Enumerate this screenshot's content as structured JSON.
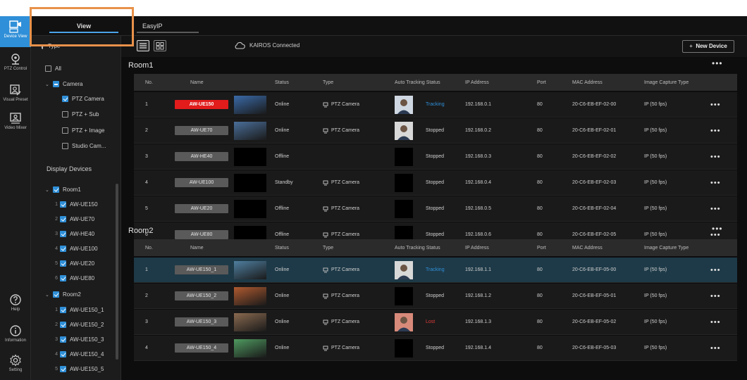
{
  "rail": {
    "items": [
      {
        "label": "Device View",
        "icon": "device-view-icon"
      },
      {
        "label": "PTZ Control",
        "icon": "ptz-control-icon"
      },
      {
        "label": "Visual Preset",
        "icon": "visual-preset-icon"
      },
      {
        "label": "Video Mixer",
        "icon": "video-mixer-icon"
      }
    ],
    "bottom": [
      {
        "label": "Help",
        "icon": "help-icon"
      },
      {
        "label": "Information",
        "icon": "information-icon"
      },
      {
        "label": "Setting",
        "icon": "settings-icon"
      }
    ]
  },
  "tabs": [
    {
      "label": "View"
    },
    {
      "label": "EasyIP"
    }
  ],
  "sidebar": {
    "type_label": "Type",
    "filter_all": "All",
    "camera": "Camera",
    "camera_types": [
      "PTZ Camera",
      "PTZ + Sub",
      "PTZ + Image",
      "Studio Cam..."
    ],
    "display_devices": "Display Devices",
    "room1": "Room1",
    "room1_items": [
      "AW-UE150",
      "AW-UE70",
      "AW-HE40",
      "AW-UE100",
      "AW-UE20",
      "AW-UE80"
    ],
    "room2": "Room2",
    "room2_items": [
      "AW-UE150_1",
      "AW-UE150_2",
      "AW-UE150_3",
      "AW-UE150_4",
      "AW-UE150_5"
    ]
  },
  "toolbar": {
    "kairos": "KAIROS Connected",
    "new_device": "New Device"
  },
  "columns": [
    "No.",
    "Name",
    "Status",
    "Type",
    "Auto Tracking Status",
    "IP Address",
    "Port",
    "MAC Address",
    "Image Capture Type"
  ],
  "rooms": [
    {
      "title": "Room1",
      "rows": [
        {
          "no": "1",
          "name": "AW-UE150",
          "status": "Online",
          "type": "PTZ Camera",
          "tracking": "Tracking",
          "ip": "192.168.0.1",
          "port": "80",
          "mac": "20-C6-EB-EF-02-00",
          "capture": "IP (50 fps)"
        },
        {
          "no": "2",
          "name": "AW-UE70",
          "status": "Online",
          "type": "PTZ Camera",
          "tracking": "Stopped",
          "ip": "192.168.0.2",
          "port": "80",
          "mac": "20-C6-EB-EF-02-01",
          "capture": "IP (50 fps)"
        },
        {
          "no": "3",
          "name": "AW-HE40",
          "status": "Offline",
          "type": "",
          "tracking": "Stopped",
          "ip": "192.168.0.3",
          "port": "80",
          "mac": "20-C6-EB-EF-02-02",
          "capture": "IP (50 fps)"
        },
        {
          "no": "4",
          "name": "AW-UE100",
          "status": "Standby",
          "type": "PTZ Camera",
          "tracking": "Stopped",
          "ip": "192.168.0.4",
          "port": "80",
          "mac": "20-C6-EB-EF-02-03",
          "capture": "IP (50 fps)"
        },
        {
          "no": "5",
          "name": "AW-UE20",
          "status": "Offline",
          "type": "PTZ Camera",
          "tracking": "Stopped",
          "ip": "192.168.0.5",
          "port": "80",
          "mac": "20-C6-EB-EF-02-04",
          "capture": "IP (50 fps)"
        },
        {
          "no": "6",
          "name": "AW-UE80",
          "status": "Offline",
          "type": "PTZ Camera",
          "tracking": "Stopped",
          "ip": "192.168.0.6",
          "port": "80",
          "mac": "20-C6-EB-EF-02-05",
          "capture": "IP (50 fps)"
        }
      ]
    },
    {
      "title": "Room2",
      "rows": [
        {
          "no": "1",
          "name": "AW-UE150_1",
          "status": "Online",
          "type": "PTZ Camera",
          "tracking": "Tracking",
          "ip": "192.168.1.1",
          "port": "80",
          "mac": "20-C6-EB-EF-05-00",
          "capture": "IP (50 fps)"
        },
        {
          "no": "2",
          "name": "AW-UE150_2",
          "status": "Online",
          "type": "PTZ Camera",
          "tracking": "Stopped",
          "ip": "192.168.1.2",
          "port": "80",
          "mac": "20-C6-EB-EF-05-01",
          "capture": "IP (50 fps)"
        },
        {
          "no": "3",
          "name": "AW-UE150_3",
          "status": "Online",
          "type": "PTZ Camera",
          "tracking": "Lost",
          "ip": "192.168.1.3",
          "port": "80",
          "mac": "20-C6-EB-EF-05-02",
          "capture": "IP (50 fps)"
        },
        {
          "no": "4",
          "name": "AW-UE150_4",
          "status": "Online",
          "type": "PTZ Camera",
          "tracking": "Stopped",
          "ip": "192.168.1.4",
          "port": "80",
          "mac": "20-C6-EB-EF-05-03",
          "capture": "IP (50 fps)"
        }
      ]
    }
  ],
  "colors": {
    "accent": "#2f8fd8",
    "live_red": "#e21b1b",
    "lost_red": "#e03a3a",
    "callout": "#e8914a"
  }
}
